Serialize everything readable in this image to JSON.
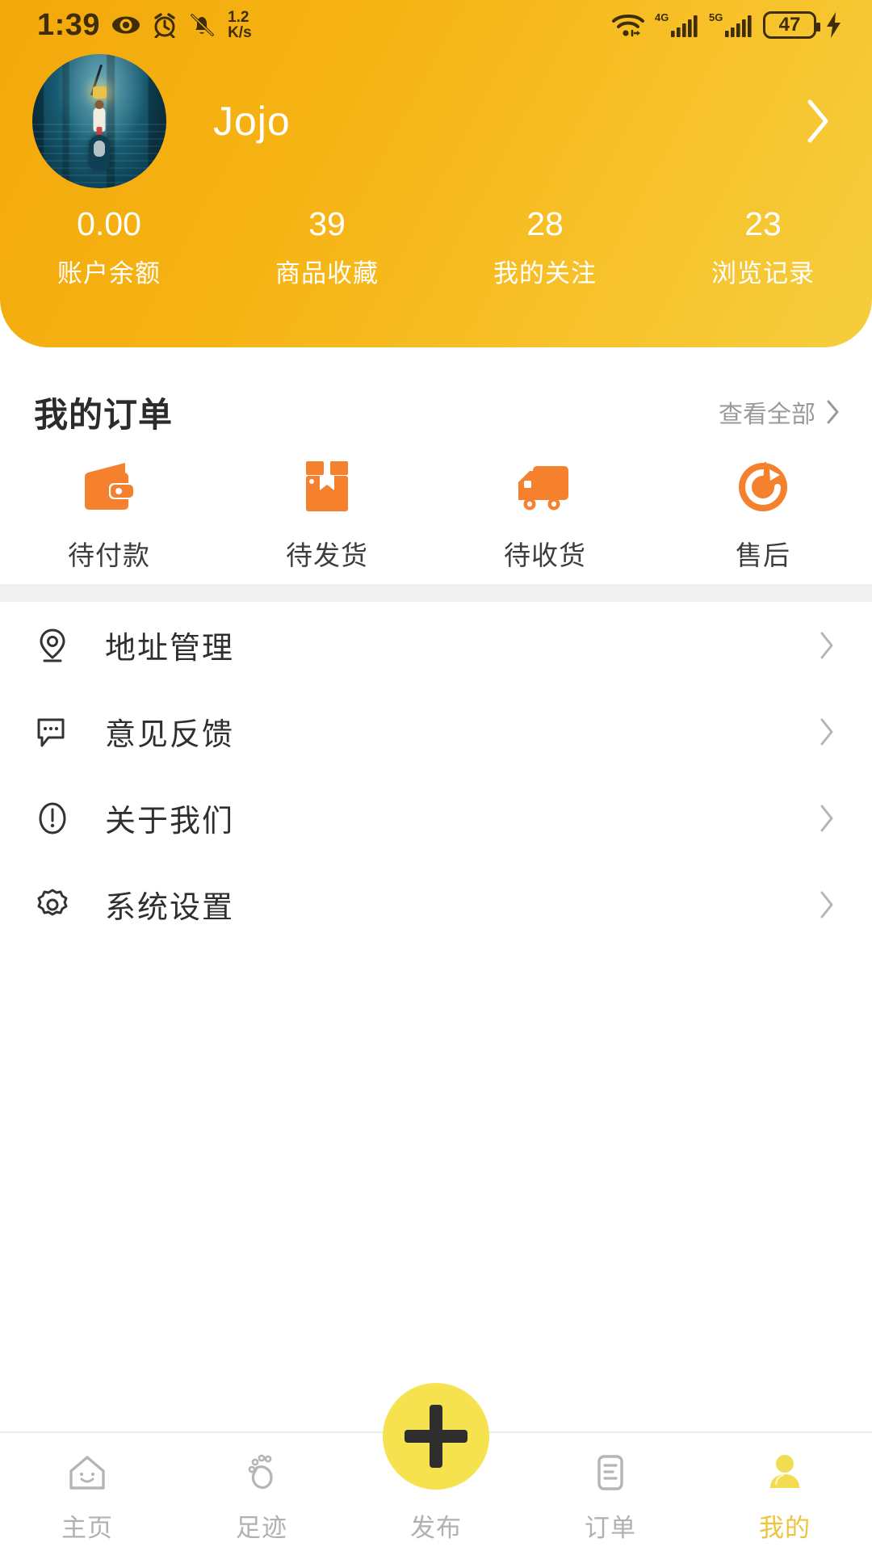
{
  "status_bar": {
    "time": "1:39",
    "net_speed_value": "1.2",
    "net_speed_unit": "K/s",
    "sim1_label": "4G",
    "sim2_label": "5G",
    "battery_percent": "47",
    "icons": [
      "eye-icon",
      "alarm-icon",
      "mute-bell-icon",
      "wifi-icon",
      "signal-icon",
      "battery-icon",
      "charging-bolt-icon"
    ]
  },
  "profile": {
    "username": "Jojo",
    "avatar_alt": "user-avatar",
    "chevron": "›"
  },
  "stats": [
    {
      "value": "0.00",
      "label": "账户余额"
    },
    {
      "value": "39",
      "label": "商品收藏"
    },
    {
      "value": "28",
      "label": "我的关注"
    },
    {
      "value": "23",
      "label": "浏览记录"
    }
  ],
  "orders": {
    "title": "我的订单",
    "view_all": "查看全部",
    "items": [
      {
        "label": "待付款",
        "icon": "wallet-icon"
      },
      {
        "label": "待发货",
        "icon": "package-icon"
      },
      {
        "label": "待收货",
        "icon": "truck-icon"
      },
      {
        "label": "售后",
        "icon": "refresh-icon"
      }
    ]
  },
  "menu": [
    {
      "label": "地址管理",
      "icon": "location-pin-icon"
    },
    {
      "label": "意见反馈",
      "icon": "chat-bubble-icon"
    },
    {
      "label": "关于我们",
      "icon": "info-circle-icon"
    },
    {
      "label": "系统设置",
      "icon": "gear-icon"
    }
  ],
  "bottom_nav": [
    {
      "label": "主页",
      "icon": "home-icon",
      "active": false
    },
    {
      "label": "足迹",
      "icon": "footprint-icon",
      "active": false
    },
    {
      "label": "发布",
      "icon": "plus-icon",
      "active": false
    },
    {
      "label": "订单",
      "icon": "list-icon",
      "active": false
    },
    {
      "label": "我的",
      "icon": "person-icon",
      "active": true
    }
  ],
  "colors": {
    "header_gradient_start": "#F3A80B",
    "header_gradient_end": "#F5CE3E",
    "order_icon": "#F5812F",
    "fab": "#F5E24E",
    "active_nav": "#EBC53D",
    "inactive_nav": "#B1B1B1",
    "separator": "#F0F0F2"
  }
}
